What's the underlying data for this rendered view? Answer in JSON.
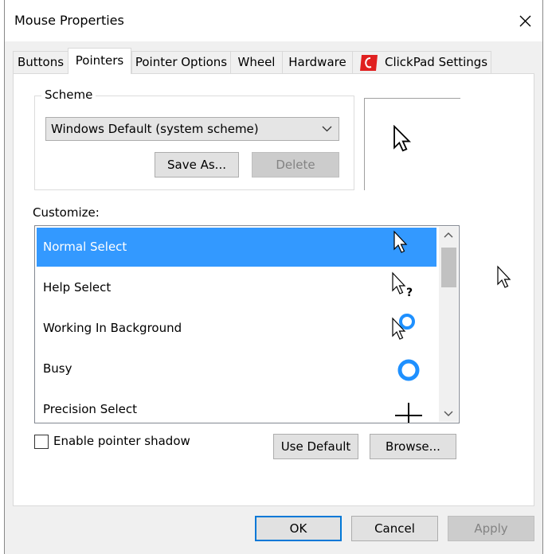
{
  "window": {
    "title": "Mouse Properties"
  },
  "tabs": [
    {
      "label": "Buttons"
    },
    {
      "label": "Pointers"
    },
    {
      "label": "Pointer Options"
    },
    {
      "label": "Wheel"
    },
    {
      "label": "Hardware"
    },
    {
      "label": "ClickPad Settings"
    }
  ],
  "scheme": {
    "group_label": "Scheme",
    "selected": "Windows Default (system scheme)",
    "save_as_label": "Save As...",
    "delete_label": "Delete"
  },
  "customize": {
    "label": "Customize:",
    "items": [
      {
        "label": "Normal Select",
        "icon": "arrow-cursor-icon"
      },
      {
        "label": "Help Select",
        "icon": "help-cursor-icon"
      },
      {
        "label": "Working In Background",
        "icon": "working-background-cursor-icon"
      },
      {
        "label": "Busy",
        "icon": "busy-cursor-icon"
      },
      {
        "label": "Precision Select",
        "icon": "crosshair-cursor-icon"
      }
    ]
  },
  "shadow": {
    "label": "Enable pointer shadow",
    "checked": false
  },
  "actions": {
    "use_default_label": "Use Default",
    "browse_label": "Browse..."
  },
  "footer": {
    "ok_label": "OK",
    "cancel_label": "Cancel",
    "apply_label": "Apply"
  },
  "colors": {
    "selection": "#3399ff",
    "focus_border": "#0078d7",
    "busy_ring": "#1e90ff",
    "clickpad_icon": "#e02020"
  }
}
